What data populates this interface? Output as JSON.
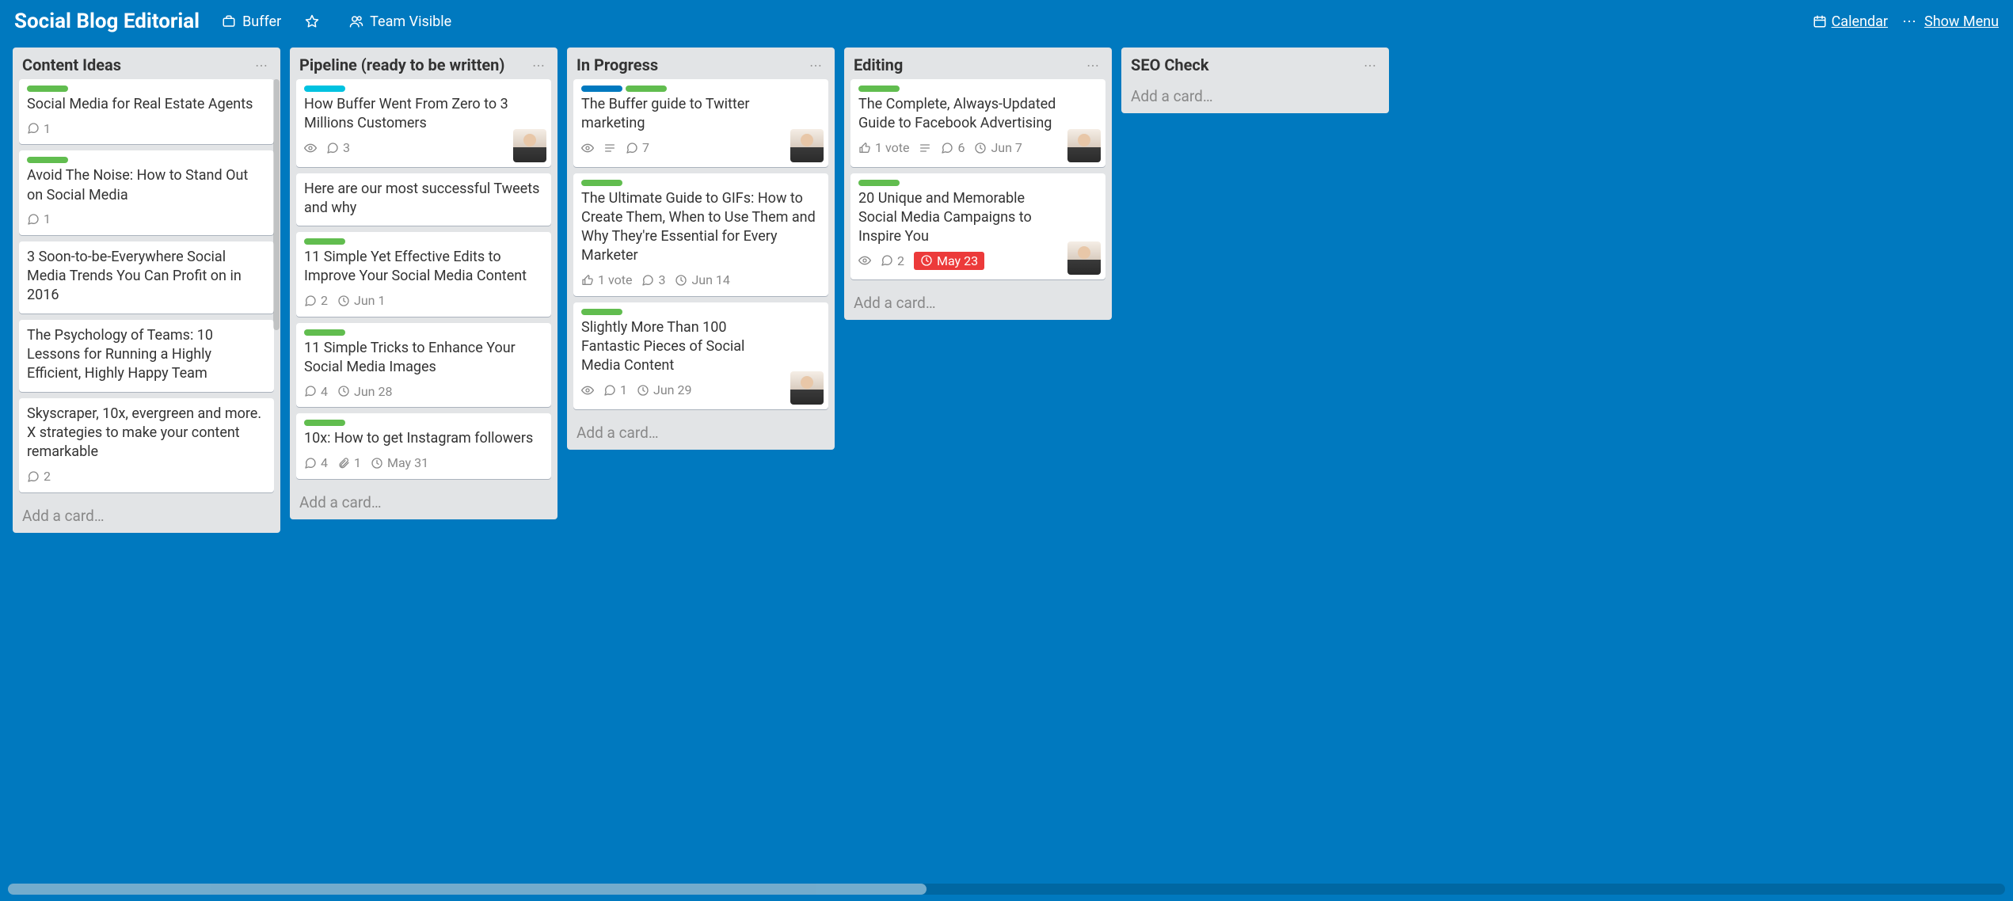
{
  "header": {
    "board_title": "Social Blog Editorial",
    "org_label": "Buffer",
    "visibility_label": "Team Visible",
    "calendar_label": "Calendar",
    "show_menu_label": "Show Menu"
  },
  "lists": [
    {
      "title": "Content Ideas",
      "add_card_label": "Add a card…",
      "cards": [
        {
          "labels": [
            "green"
          ],
          "title": "Social Media for Real Estate Agents",
          "badges": {
            "comments": 1
          }
        },
        {
          "labels": [
            "green"
          ],
          "title": "Avoid The Noise: How to Stand Out on Social Media",
          "badges": {
            "comments": 1
          }
        },
        {
          "labels": [],
          "title": "3 Soon-to-be-Everywhere Social Media Trends You Can Profit on in 2016",
          "badges": {}
        },
        {
          "labels": [],
          "title": "The Psychology of Teams: 10 Lessons for Running a Highly Efficient, Highly Happy Team",
          "badges": {}
        },
        {
          "labels": [],
          "title": "Skyscraper, 10x, evergreen and more. X strategies to make your content remarkable",
          "badges": {
            "comments": 2
          }
        }
      ]
    },
    {
      "title": "Pipeline (ready to be written)",
      "add_card_label": "Add a card…",
      "cards": [
        {
          "labels": [
            "cyan"
          ],
          "title": "How Buffer Went From Zero to 3 Millions Customers",
          "badges": {
            "watch": true,
            "comments": 3
          },
          "avatar": true
        },
        {
          "labels": [],
          "title": "Here are our most successful Tweets and why",
          "badges": {}
        },
        {
          "labels": [
            "green"
          ],
          "title": "11 Simple Yet Effective Edits to Improve Your Social Media Content",
          "badges": {
            "comments": 2,
            "due": "Jun 1"
          }
        },
        {
          "labels": [
            "green"
          ],
          "title": "11 Simple Tricks to Enhance Your Social Media Images",
          "badges": {
            "comments": 4,
            "due": "Jun 28"
          }
        },
        {
          "labels": [
            "green"
          ],
          "title": "10x: How to get Instagram followers",
          "badges": {
            "comments": 4,
            "attachments": 1,
            "due": "May 31"
          }
        }
      ]
    },
    {
      "title": "In Progress",
      "add_card_label": "Add a card…",
      "cards": [
        {
          "labels": [
            "blue",
            "green"
          ],
          "title": "The Buffer guide to Twitter marketing",
          "badges": {
            "watch": true,
            "desc": true,
            "comments": 7
          },
          "avatar": true
        },
        {
          "labels": [
            "green"
          ],
          "title": "The Ultimate Guide to GIFs: How to Create Them, When to Use Them and Why They're Essential for Every Marketer",
          "badges": {
            "votes": "1 vote",
            "comments": 3,
            "due": "Jun 14"
          }
        },
        {
          "labels": [
            "green"
          ],
          "title": "Slightly More Than 100 Fantastic Pieces of Social Media Content",
          "badges": {
            "watch": true,
            "comments": 1,
            "due": "Jun 29"
          },
          "avatar": true
        }
      ]
    },
    {
      "title": "Editing",
      "add_card_label": "Add a card…",
      "cards": [
        {
          "labels": [
            "green"
          ],
          "title": "The Complete, Always-Updated Guide to Facebook Advertising",
          "badges": {
            "votes": "1 vote",
            "desc": true,
            "comments": 6,
            "due": "Jun 7"
          },
          "avatar": true
        },
        {
          "labels": [
            "green"
          ],
          "title": "20 Unique and Memorable Social Media Campaigns to Inspire You",
          "badges": {
            "watch": true,
            "comments": 2,
            "due_overdue": "May 23"
          },
          "avatar": true
        }
      ]
    },
    {
      "title": "SEO Check",
      "add_card_label": "Add a card…",
      "cards": []
    }
  ]
}
